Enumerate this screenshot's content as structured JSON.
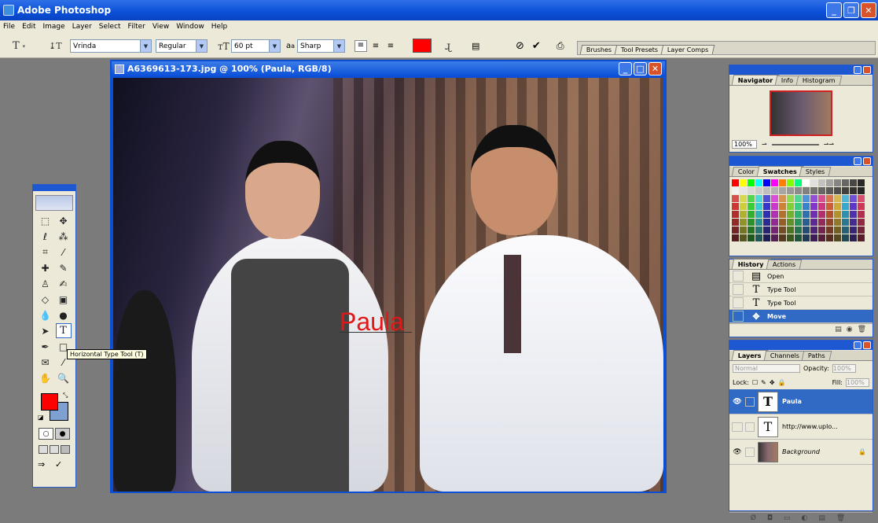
{
  "app": {
    "title": "Adobe Photoshop"
  },
  "menu": [
    "File",
    "Edit",
    "Image",
    "Layer",
    "Select",
    "Filter",
    "View",
    "Window",
    "Help"
  ],
  "options": {
    "font_family": "Vrinda",
    "font_style": "Regular",
    "font_size": "60 pt",
    "antialias_label": "a",
    "antialias": "Sharp",
    "text_color": "#ff0000",
    "well_tabs": [
      "Brushes",
      "Tool Presets",
      "Layer Comps"
    ]
  },
  "document": {
    "title": "A6369613-173.jpg @ 100% (Paula, RGB/8)",
    "typed_text": "Paula"
  },
  "toolbox": {
    "tooltip": "Horizontal Type Tool (T)",
    "fg_color": "#ff0000",
    "bg_color": "#7ea1d2"
  },
  "navigator": {
    "tabs": [
      "Navigator",
      "Info",
      "Histogram"
    ],
    "zoom": "100%"
  },
  "color_panel": {
    "tabs": [
      "Color",
      "Swatches",
      "Styles"
    ]
  },
  "history": {
    "tabs": [
      "History",
      "Actions"
    ],
    "items": [
      {
        "label": "Open",
        "icon": "▤"
      },
      {
        "label": "Type Tool",
        "icon": "T"
      },
      {
        "label": "Type Tool",
        "icon": "T"
      },
      {
        "label": "Move",
        "icon": "✥"
      }
    ]
  },
  "layers": {
    "tabs": [
      "Layers",
      "Channels",
      "Paths"
    ],
    "blend_mode": "Normal",
    "opacity_label": "Opacity:",
    "opacity": "100%",
    "lock_label": "Lock:",
    "fill_label": "Fill:",
    "fill": "100%",
    "items": [
      {
        "name": "Paula"
      },
      {
        "name": "http://www.uplo..."
      },
      {
        "name": "Background"
      }
    ]
  }
}
